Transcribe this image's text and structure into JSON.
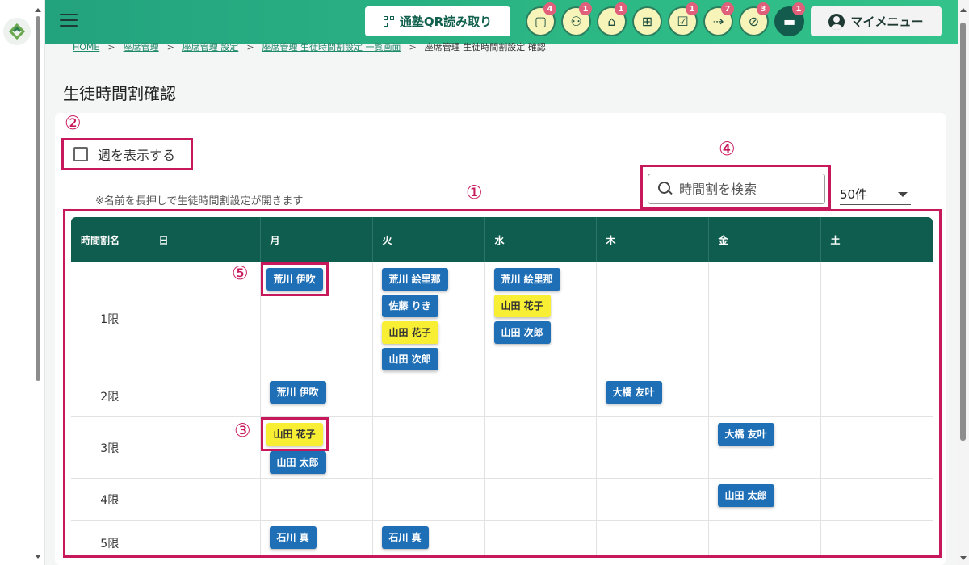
{
  "header": {
    "qr_button": "通塾QR読み取り",
    "icons": [
      {
        "name": "message-icon",
        "badge": "4",
        "glyph": "▢"
      },
      {
        "name": "group-icon",
        "badge": "1",
        "glyph": "⚇"
      },
      {
        "name": "school-icon",
        "badge": "1",
        "glyph": "⌂"
      },
      {
        "name": "gift-icon",
        "badge": "",
        "glyph": "⊞"
      },
      {
        "name": "checklist-icon",
        "badge": "1",
        "glyph": "☑"
      },
      {
        "name": "arrows-in-icon",
        "badge": "7",
        "glyph": "⇢"
      },
      {
        "name": "no-location-icon",
        "badge": "3",
        "glyph": "⊘"
      },
      {
        "name": "chat-icon",
        "badge": "1",
        "glyph": "▬"
      }
    ],
    "my_menu": "マイメニュー"
  },
  "breadcrumb": {
    "items": [
      "HOME",
      "座席管理",
      "座席管理 設定",
      "座席管理 生徒時間割設定 一覧画面"
    ],
    "current": "座席管理 生徒時間割設定 確認",
    "separator": ">"
  },
  "page": {
    "title": "生徒時間割確認",
    "week_toggle_label": "週を表示する",
    "note": "※名前を長押しで生徒時間割設定が開きます",
    "search_placeholder": "時間割を検索",
    "per_page": "50件"
  },
  "markers": {
    "m1": "①",
    "m2": "②",
    "m3": "③",
    "m4": "④",
    "m5": "⑤"
  },
  "table": {
    "headers": [
      "時間割名",
      "日",
      "月",
      "火",
      "水",
      "木",
      "金",
      "土"
    ],
    "rows": [
      {
        "period": "1限",
        "cells": [
          [],
          [
            {
              "name": "荒川 伊吹",
              "color": "blue",
              "highlight": "⑤"
            }
          ],
          [
            {
              "name": "荒川 絵里那",
              "color": "blue"
            },
            {
              "name": "佐藤 りき",
              "color": "blue"
            },
            {
              "name": "山田 花子",
              "color": "yellow"
            },
            {
              "name": "山田 次郎",
              "color": "blue"
            }
          ],
          [
            {
              "name": "荒川 絵里那",
              "color": "blue"
            },
            {
              "name": "山田 花子",
              "color": "yellow"
            },
            {
              "name": "山田 次郎",
              "color": "blue"
            }
          ],
          [],
          [],
          []
        ]
      },
      {
        "period": "2限",
        "cells": [
          [],
          [
            {
              "name": "荒川 伊吹",
              "color": "blue"
            }
          ],
          [],
          [],
          [
            {
              "name": "大橋 友叶",
              "color": "blue"
            }
          ],
          [],
          []
        ]
      },
      {
        "period": "3限",
        "cells": [
          [],
          [
            {
              "name": "山田 花子",
              "color": "yellow",
              "highlight": "③"
            },
            {
              "name": "山田 太郎",
              "color": "blue"
            }
          ],
          [],
          [],
          [],
          [
            {
              "name": "大橋 友叶",
              "color": "blue"
            }
          ],
          []
        ]
      },
      {
        "period": "4限",
        "cells": [
          [],
          [],
          [],
          [],
          [],
          [
            {
              "name": "山田 太郎",
              "color": "blue"
            }
          ],
          []
        ]
      },
      {
        "period": "5限",
        "cells": [
          [],
          [
            {
              "name": "石川 真",
              "color": "blue"
            }
          ],
          [
            {
              "name": "石川 真",
              "color": "blue"
            }
          ],
          [],
          [],
          [],
          []
        ]
      }
    ]
  },
  "colors": {
    "brand": "#23a27e",
    "header_row": "#0f5d4f",
    "chip_blue": "#1e6fb6",
    "chip_yellow": "#f8ef35",
    "marker": "#c8185c"
  }
}
